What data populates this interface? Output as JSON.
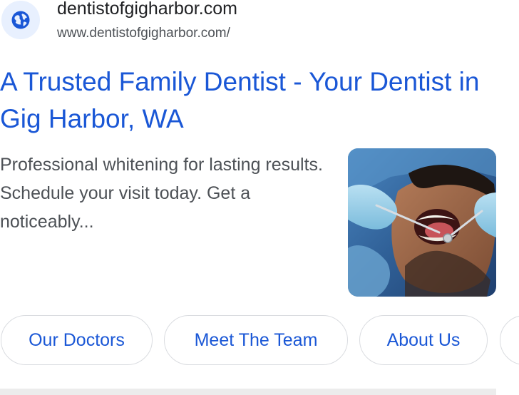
{
  "result": {
    "site_name": "dentistofgigharbor.com",
    "site_url": "www.dentistofgigharbor.com/",
    "title": "A Trusted Family Dentist - Your Dentist in Gig Harbor, WA",
    "snippet": "Professional whitening for lasting results. Schedule your visit today. Get a noticeably...",
    "favicon_icon": "globe-icon",
    "thumbnail_icon": "dental-exam-photo"
  },
  "sitelinks": [
    {
      "label": "Our Doctors"
    },
    {
      "label": "Meet The Team"
    },
    {
      "label": "About Us"
    },
    {
      "label": ""
    }
  ],
  "colors": {
    "link": "#1a57d6",
    "text": "#202124",
    "secondary": "#4d5156",
    "favicon_bg": "#e8f0fe",
    "chip_border": "#dadce0"
  }
}
